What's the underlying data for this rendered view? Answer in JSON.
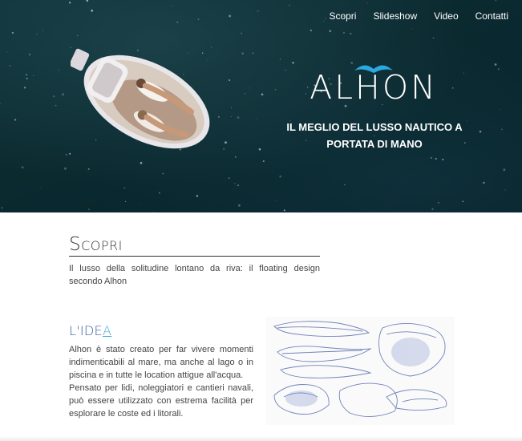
{
  "nav": {
    "items": [
      "Scopri",
      "Slideshow",
      "Video",
      "Contatti"
    ]
  },
  "hero": {
    "brand": "ALHON",
    "tagline_line1": "Il meglio del lusso nautico a",
    "tagline_line2": "portata di mano"
  },
  "scopri": {
    "title": "Scopri",
    "description": "Il lusso della solitudine lontano da riva: il floating design secondo Alhon"
  },
  "idea": {
    "title_main": "L'IDE",
    "title_accent": "A",
    "paragraph1": "Alhon è stato creato per far vivere momenti indimenticabili al mare, ma anche al lago o in piscina e in tutte le location attigue all'acqua.",
    "paragraph2": "Pensato per lidi, noleggiatori e cantieri navali, può essere utilizzato con estrema facilità per esplorare le coste ed i litorali."
  },
  "colors": {
    "sea": "#0b2a30",
    "logo_wing": "#2aa8e0",
    "idea_title": "#3a5aa0",
    "idea_accent": "#39a9d8"
  },
  "icons": {
    "logo_mark": "seagull-wing-icon"
  }
}
